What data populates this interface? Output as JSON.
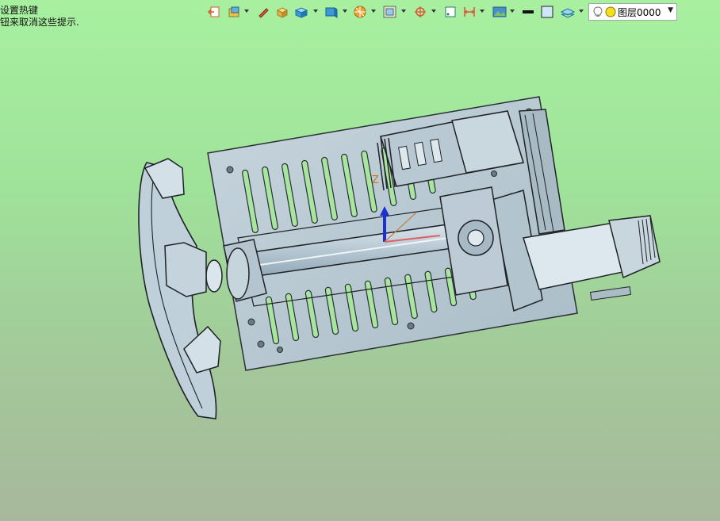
{
  "hint": {
    "line1": "设置热键",
    "line2": "钮来取消这些提示."
  },
  "toolbar": {
    "items": [
      {
        "icon": "exit-sketch-icon"
      },
      {
        "icon": "render-mode-icon",
        "dropdown": true
      },
      {
        "icon": "paint-icon"
      },
      {
        "icon": "shaded-box-icon"
      },
      {
        "icon": "cube-view-icon",
        "dropdown": true
      },
      {
        "icon": "view-orient-icon",
        "dropdown": true
      },
      {
        "icon": "section-icon",
        "dropdown": true
      },
      {
        "icon": "zoom-window-icon",
        "dropdown": true
      },
      {
        "icon": "snap-icon",
        "dropdown": true
      },
      {
        "icon": "frame-icon"
      },
      {
        "icon": "dimension-icon",
        "dropdown": true
      },
      {
        "icon": "image-icon",
        "dropdown": true
      },
      {
        "icon": "line-color-icon"
      },
      {
        "icon": "fill-color-icon"
      },
      {
        "icon": "layer-stack-icon",
        "dropdown": true
      }
    ],
    "layer": {
      "value": "图层0000"
    }
  },
  "viewport": {
    "axis_label": "Z",
    "background_top": "#a8f0a0",
    "background_bottom": "#a8b89c"
  }
}
